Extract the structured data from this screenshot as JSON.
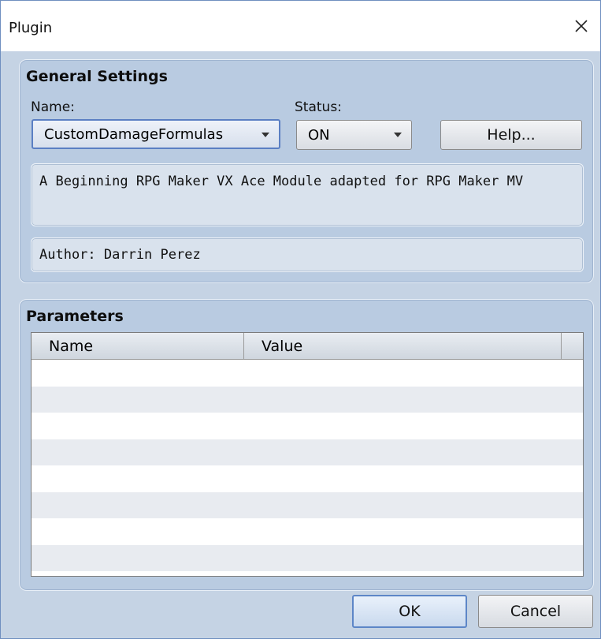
{
  "window": {
    "title": "Plugin"
  },
  "general": {
    "title": "General Settings",
    "name_label": "Name:",
    "name_value": "CustomDamageFormulas",
    "status_label": "Status:",
    "status_value": "ON",
    "help_label": "Help...",
    "description": "A Beginning RPG Maker VX Ace Module adapted for RPG Maker MV",
    "author": "Author: Darrin Perez"
  },
  "parameters": {
    "title": "Parameters",
    "columns": [
      "Name",
      "Value"
    ],
    "rows": []
  },
  "footer": {
    "ok_label": "OK",
    "cancel_label": "Cancel"
  },
  "icons": {
    "close": "close-icon",
    "dropdown": "chevron-down-icon"
  }
}
